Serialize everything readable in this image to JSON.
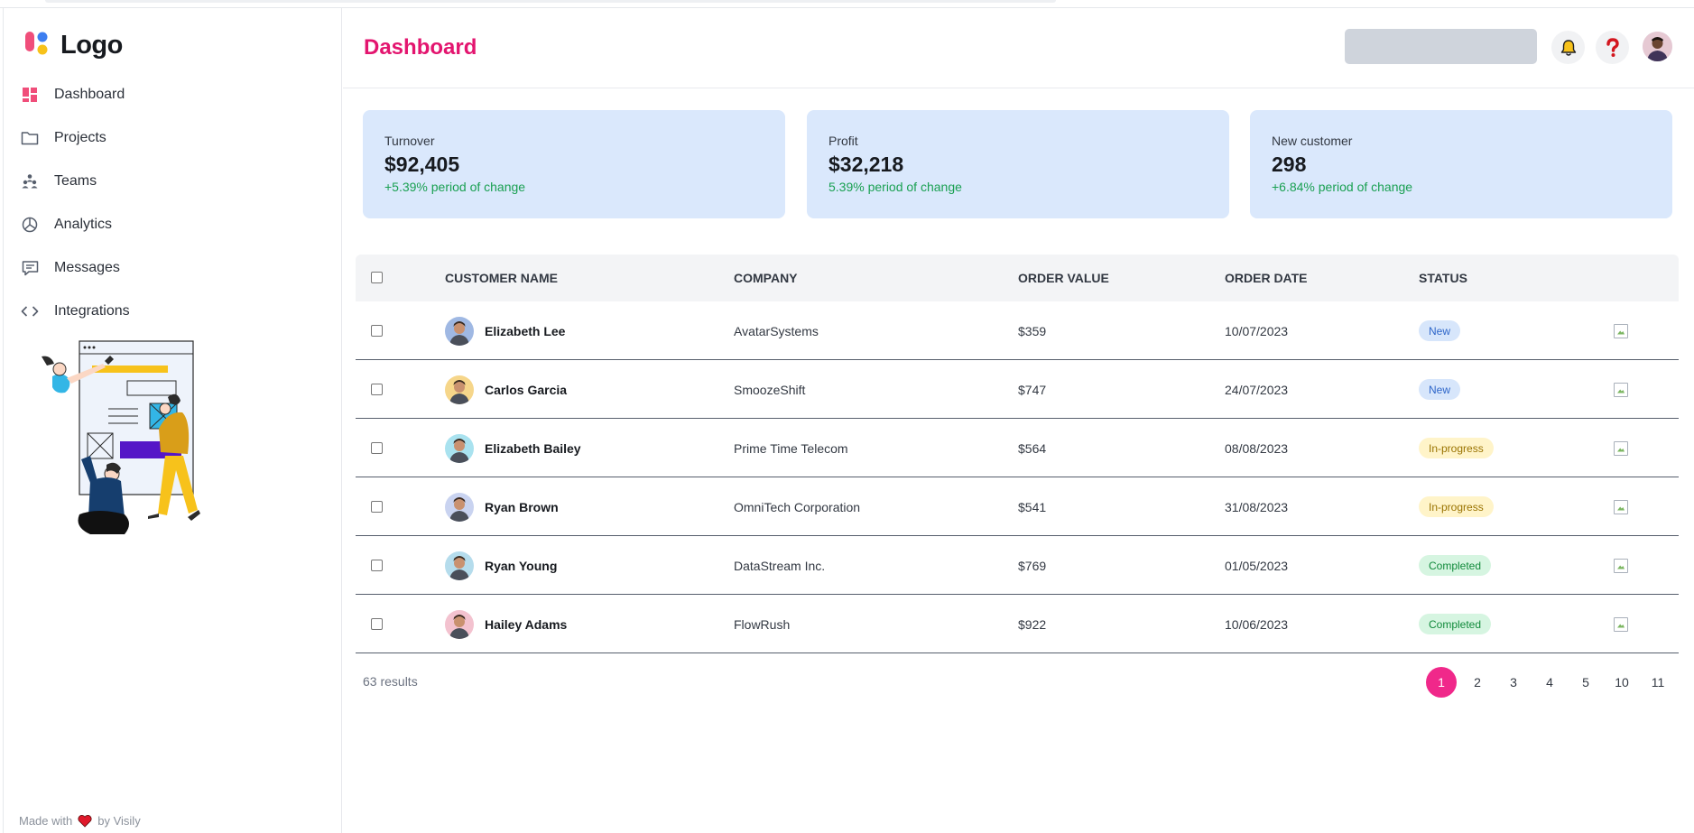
{
  "app": {
    "logo_text": "Logo",
    "page_title": "Dashboard"
  },
  "sidebar": {
    "items": [
      {
        "label": "Dashboard",
        "icon": "dashboard-grid-icon",
        "active": true
      },
      {
        "label": "Projects",
        "icon": "folder-icon"
      },
      {
        "label": "Teams",
        "icon": "teams-icon"
      },
      {
        "label": "Analytics",
        "icon": "pie-chart-icon"
      },
      {
        "label": "Messages",
        "icon": "message-icon"
      },
      {
        "label": "Integrations",
        "icon": "code-brackets-icon"
      }
    ],
    "footer_prefix": "Made with",
    "footer_suffix": "by Visily"
  },
  "header": {
    "search_placeholder": "",
    "icons": [
      "bell-icon",
      "help-icon",
      "user-avatar"
    ]
  },
  "stats": [
    {
      "label": "Turnover",
      "value": "$92,405",
      "change": "+5.39% period of change"
    },
    {
      "label": "Profit",
      "value": "$32,218",
      "change": "5.39% period of change"
    },
    {
      "label": "New customer",
      "value": "298",
      "change": "+6.84% period of change"
    }
  ],
  "table": {
    "columns": [
      "CUSTOMER NAME",
      "COMPANY",
      "ORDER VALUE",
      "ORDER DATE",
      "STATUS"
    ],
    "rows": [
      {
        "name": "Elizabeth Lee",
        "company": "AvatarSystems",
        "value": "$359",
        "date": "10/07/2023",
        "status": "New",
        "status_type": "new",
        "avatar_bg": "#9fb8e3"
      },
      {
        "name": "Carlos Garcia",
        "company": "SmoozeShift",
        "value": "$747",
        "date": "24/07/2023",
        "status": "New",
        "status_type": "new",
        "avatar_bg": "#f6d68a"
      },
      {
        "name": "Elizabeth Bailey",
        "company": "Prime Time Telecom",
        "value": "$564",
        "date": "08/08/2023",
        "status": "In-progress",
        "status_type": "progress",
        "avatar_bg": "#a9e2ef"
      },
      {
        "name": "Ryan Brown",
        "company": "OmniTech Corporation",
        "value": "$541",
        "date": "31/08/2023",
        "status": "In-progress",
        "status_type": "progress",
        "avatar_bg": "#c9d3f0"
      },
      {
        "name": "Ryan Young",
        "company": "DataStream Inc.",
        "value": "$769",
        "date": "01/05/2023",
        "status": "Completed",
        "status_type": "completed",
        "avatar_bg": "#b5dcec"
      },
      {
        "name": "Hailey Adams",
        "company": "FlowRush",
        "value": "$922",
        "date": "10/06/2023",
        "status": "Completed",
        "status_type": "completed",
        "avatar_bg": "#f3c2cf"
      }
    ],
    "results_text": "63 results"
  },
  "pagination": {
    "pages": [
      "1",
      "2",
      "3",
      "4",
      "5",
      "10",
      "11"
    ],
    "current": "1"
  },
  "colors": {
    "accent": "#e3156f",
    "pagination_active": "#f0288a",
    "card_bg": "#dae8fc",
    "positive": "#1aa052"
  }
}
